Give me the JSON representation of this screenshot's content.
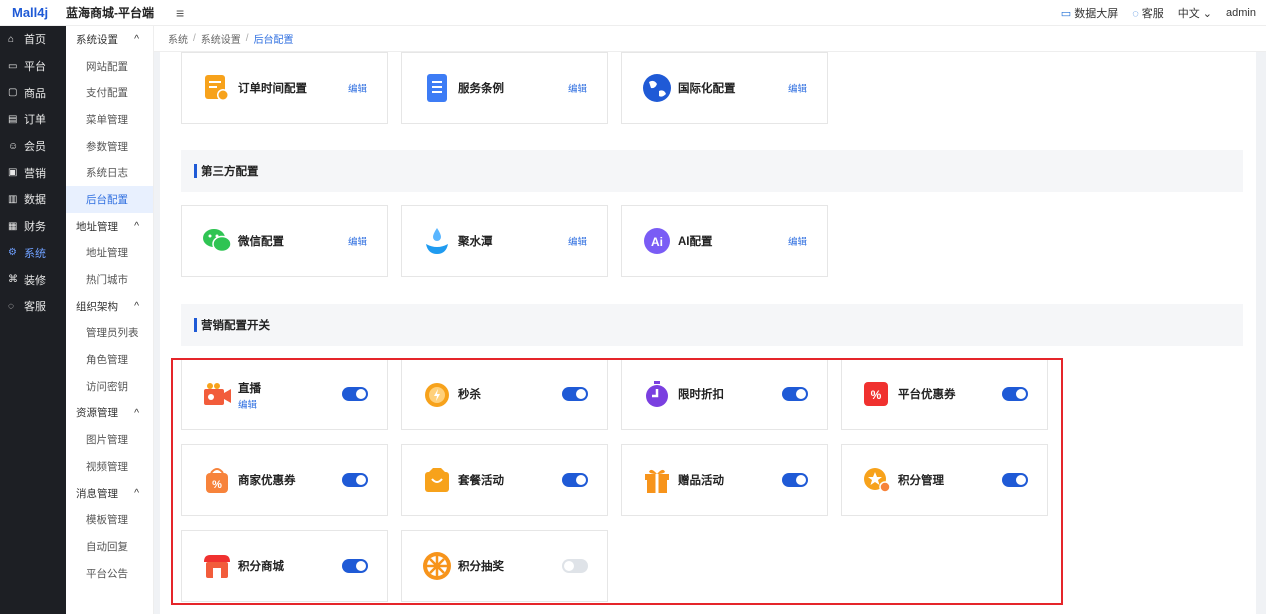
{
  "header": {
    "logo": "Mall4j",
    "title": "蓝海商城-平台端",
    "menu_icon": "≡",
    "right": [
      "数据大屏",
      "客服",
      "中文",
      "admin"
    ]
  },
  "sidebar": [
    {
      "icon": "⌂",
      "label": "首页"
    },
    {
      "icon": "▭",
      "label": "平台"
    },
    {
      "icon": "▢",
      "label": "商品"
    },
    {
      "icon": "▤",
      "label": "订单"
    },
    {
      "icon": "☺",
      "label": "会员"
    },
    {
      "icon": "▣",
      "label": "营销"
    },
    {
      "icon": "▥",
      "label": "数据"
    },
    {
      "icon": "▦",
      "label": "财务"
    },
    {
      "icon": "⚙",
      "label": "系统"
    },
    {
      "icon": "⌘",
      "label": "装修"
    },
    {
      "icon": "◌",
      "label": "客服"
    }
  ],
  "submenu": [
    {
      "type": "group",
      "label": "系统设置"
    },
    {
      "type": "item",
      "label": "网站配置"
    },
    {
      "type": "item",
      "label": "支付配置"
    },
    {
      "type": "item",
      "label": "菜单管理"
    },
    {
      "type": "item",
      "label": "参数管理"
    },
    {
      "type": "item",
      "label": "系统日志"
    },
    {
      "type": "item",
      "label": "后台配置",
      "active": true
    },
    {
      "type": "group",
      "label": "地址管理"
    },
    {
      "type": "item",
      "label": "地址管理"
    },
    {
      "type": "item",
      "label": "热门城市"
    },
    {
      "type": "group",
      "label": "组织架构"
    },
    {
      "type": "item",
      "label": "管理员列表"
    },
    {
      "type": "item",
      "label": "角色管理"
    },
    {
      "type": "item",
      "label": "访问密钥"
    },
    {
      "type": "group",
      "label": "资源管理"
    },
    {
      "type": "item",
      "label": "图片管理"
    },
    {
      "type": "item",
      "label": "视频管理"
    },
    {
      "type": "group",
      "label": "消息管理"
    },
    {
      "type": "item",
      "label": "模板管理"
    },
    {
      "type": "item",
      "label": "自动回复"
    },
    {
      "type": "item",
      "label": "平台公告"
    }
  ],
  "breadcrumb": [
    "系统",
    "系统设置",
    "后台配置"
  ],
  "edit_label": "编辑",
  "top_cards": [
    {
      "label": "订单时间配置",
      "icon": "clock-doc-icon",
      "color": "#f7a21b"
    },
    {
      "label": "服务条例",
      "icon": "list-doc-icon",
      "color": "#3d7cf5"
    },
    {
      "label": "国际化配置",
      "icon": "globe-icon",
      "color": "#1f5ad6"
    }
  ],
  "section_third": "第三方配置",
  "third_cards": [
    {
      "label": "微信配置",
      "icon": "wechat-icon",
      "color": "#2fc453"
    },
    {
      "label": "聚水潭",
      "icon": "water-drop-icon",
      "color": "#1f9bf0"
    },
    {
      "label": "AI配置",
      "icon": "ai-icon",
      "color": "#7a5cf5"
    }
  ],
  "section_marketing": "营销配置开关",
  "marketing_cards": [
    {
      "label": "直播",
      "icon": "live-camera-icon",
      "color": "#f25c3b",
      "on": true,
      "editable": true
    },
    {
      "label": "秒杀",
      "icon": "alarm-clock-icon",
      "color": "#f7a21b",
      "on": true
    },
    {
      "label": "限时折扣",
      "icon": "timer-icon",
      "color": "#7a3fe0",
      "on": true
    },
    {
      "label": "平台优惠券",
      "icon": "coupon-icon",
      "color": "#f0312f",
      "on": true
    },
    {
      "label": "商家优惠券",
      "icon": "discount-bag-icon",
      "color": "#f7833b",
      "on": true
    },
    {
      "label": "套餐活动",
      "icon": "shopping-bag-icon",
      "color": "#f7a21b",
      "on": true
    },
    {
      "label": "赠品活动",
      "icon": "gift-icon",
      "color": "#f7941b",
      "on": true
    },
    {
      "label": "积分管理",
      "icon": "points-star-icon",
      "color": "#f7a21b",
      "on": true
    },
    {
      "label": "积分商城",
      "icon": "store-icon",
      "color": "#f0312f",
      "on": true
    },
    {
      "label": "积分抽奖",
      "icon": "lottery-wheel-icon",
      "color": "#f7941b",
      "on": false
    }
  ]
}
